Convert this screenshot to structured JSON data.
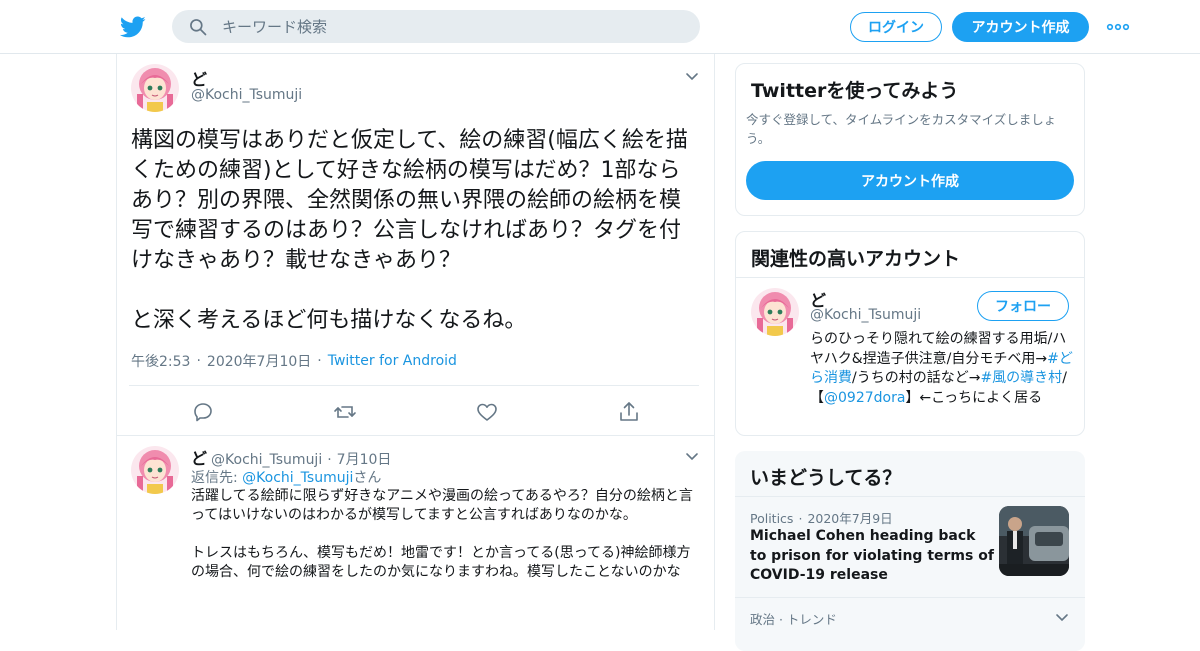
{
  "header": {
    "search_placeholder": "キーワード検索",
    "login_label": "ログイン",
    "signup_label": "アカウント作成",
    "brand_color": "#1da1f2"
  },
  "tweet": {
    "name": "ど",
    "handle": "@Kochi_Tsumuji",
    "text": "構図の模写はありだと仮定して、絵の練習(幅広く絵を描くための練習)として好きな絵柄の模写はだめ？1部ならあり？別の界隈、全然関係の無い界隈の絵師の絵柄を模写で練習するのはあり？公言しなければあり？タグを付けなきゃあり？載せなきゃあり？\n\nと深く考えるほど何も描けなくなるね。",
    "time": "午後2:53",
    "date": "2020年7月10日",
    "source": "Twitter for Android"
  },
  "reply": {
    "name": "ど",
    "handle": "@Kochi_Tsumuji",
    "date": "7月10日",
    "reply_to_prefix": "返信先: ",
    "reply_to_handle": "@Kochi_Tsumuji",
    "reply_to_suffix": "さん",
    "text": "活躍してる絵師に限らず好きなアニメや漫画の絵ってあるやろ？自分の絵柄と言ってはいけないのはわかるが模写してますと公言すればありなのかな。\n\nトレスはもちろん、模写もだめ！地雷です！とか言ってる(思ってる)神絵師様方の場合、何で絵の練習をしたのか気になりますわね。模写したことないのかな"
  },
  "sidebar": {
    "signup_card": {
      "title": "Twitterを使ってみよう",
      "desc": "今すぐ登録して、タイムラインをカスタマイズしましょう。",
      "button": "アカウント作成"
    },
    "related": {
      "title": "関連性の高いアカウント",
      "name": "ど",
      "handle": "@Kochi_Tsumuji",
      "follow_label": "フォロー",
      "bio_1": "らのひっそり隠れて絵の練習する用垢/ハヤハク&捏造子供注意/自分モチベ用→",
      "bio_tag1": "#どら消費",
      "bio_2": "/うちの村の話など→",
      "bio_tag2": "#風の導き村",
      "bio_3": "/【",
      "bio_mention": "@0927dora",
      "bio_4": "】←こっちによく居る"
    },
    "trends": {
      "title": "いまどうしてる？",
      "news_category": "Politics",
      "news_date": "2020年7月9日",
      "news_title": "Michael Cohen heading back to prison for violating terms of COVID-19 release",
      "trend_label": "政治 · トレンド"
    }
  }
}
